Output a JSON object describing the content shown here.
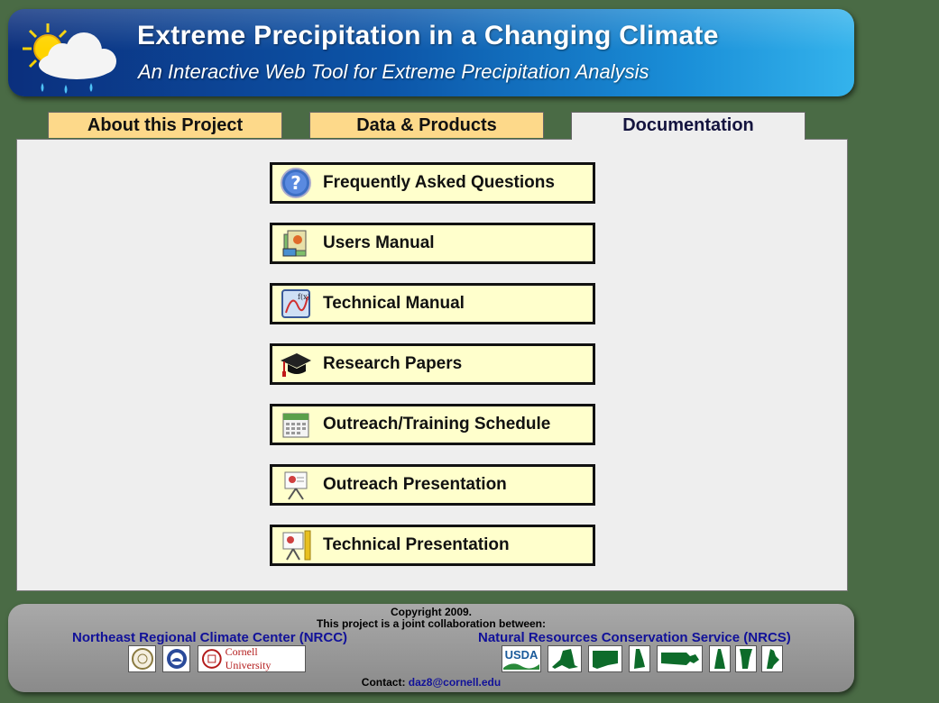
{
  "header": {
    "title": "Extreme Precipitation in a Changing Climate",
    "subtitle": "An Interactive Web Tool for Extreme Precipitation Analysis",
    "logo_icon": "sun-cloud-rain-icon"
  },
  "tabs": [
    {
      "label": "About this Project",
      "active": false
    },
    {
      "label": "Data & Products",
      "active": false
    },
    {
      "label": "Documentation",
      "active": true
    }
  ],
  "documentation": {
    "items": [
      {
        "label": "Frequently Asked Questions",
        "icon": "question-icon"
      },
      {
        "label": "Users Manual",
        "icon": "manual-icon"
      },
      {
        "label": "Technical Manual",
        "icon": "function-graph-icon"
      },
      {
        "label": "Research Papers",
        "icon": "graduation-cap-icon"
      },
      {
        "label": "Outreach/Training Schedule",
        "icon": "calendar-icon"
      },
      {
        "label": "Outreach Presentation",
        "icon": "presentation-easel-icon"
      },
      {
        "label": "Technical Presentation",
        "icon": "presentation-easel-icon"
      }
    ]
  },
  "footer": {
    "copyright": "Copyright 2009.",
    "collab": "This project is a joint collaboration between:",
    "org_left": "Northeast Regional Climate Center (NRCC)",
    "org_right": "Natural Resources Conservation Service (NRCS)",
    "left_logos": [
      "noaa-ncdc-logo",
      "nws-logo"
    ],
    "cornell_text": "Cornell University",
    "usda_text": "USDA",
    "states": [
      "new-york-state-icon",
      "connecticut-state-icon",
      "new-hampshire-state-icon",
      "massachusetts-state-icon",
      "new-hampshire-state-icon",
      "vermont-state-icon",
      "maine-state-icon"
    ],
    "contact_label": "Contact:",
    "contact_email": "daz8@cornell.edu"
  },
  "colors": {
    "background": "#4a6b45",
    "tab_inactive": "#fdd98a",
    "button_bg": "#ffffcc",
    "link": "#111199"
  }
}
